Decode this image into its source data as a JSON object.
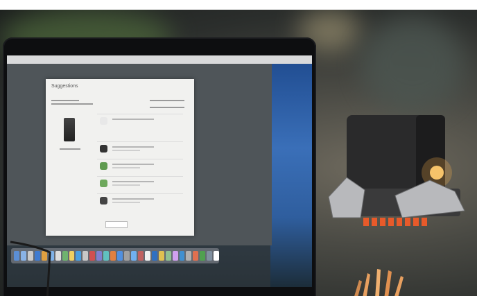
{
  "scene": {
    "colors": {
      "background": "#2b2e2c",
      "monitor_bezel": "#0d0e10",
      "connector_body": "#2a2a2b",
      "connector_metal": "#b8b9bc",
      "connector_led": "#ffd27a",
      "connector_pins": "#e85a2a",
      "pencil": "#e8a060"
    }
  },
  "screen": {
    "page_title": "Suggestions"
  },
  "dock": {
    "icons": [
      "#5b8fd6",
      "#89b3e6",
      "#c9c9c9",
      "#3f7bd0",
      "#e0a040",
      "#7fb2e8",
      "#dddddd",
      "#6fb36f",
      "#f0d060",
      "#4aa0e0",
      "#c8c8c8",
      "#d05050",
      "#8080d0",
      "#60c0c0",
      "#e08040",
      "#5090e0",
      "#a0a0a0",
      "#70b0f0",
      "#c06060",
      "#f0f0f0",
      "#3070c0",
      "#e0c050",
      "#90c090",
      "#d0a0f0",
      "#4090d0",
      "#b0b0b0",
      "#e07050",
      "#50a050",
      "#8090a0",
      "#ffffff"
    ]
  }
}
